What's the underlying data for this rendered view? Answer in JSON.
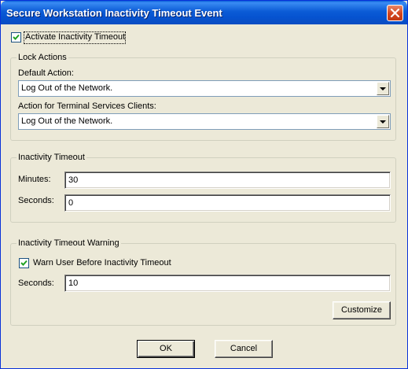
{
  "window": {
    "title": "Secure Workstation Inactivity Timeout Event"
  },
  "activate_timeout": {
    "label": "Activate Inactivity Timeout",
    "checked": true
  },
  "lock_actions": {
    "title": "Lock Actions",
    "default_action": {
      "label": "Default Action:",
      "value": "Log Out of the Network."
    },
    "terminal_services": {
      "label": "Action for Terminal Services Clients:",
      "value": "Log Out of the Network."
    }
  },
  "inactivity_timeout": {
    "title": "Inactivity Timeout",
    "minutes": {
      "label": "Minutes:",
      "value": "30"
    },
    "seconds": {
      "label": "Seconds:",
      "value": "0"
    }
  },
  "timeout_warning": {
    "title": "Inactivity Timeout Warning",
    "warn_user": {
      "label": "Warn User Before Inactivity Timeout",
      "checked": true
    },
    "seconds": {
      "label": "Seconds:",
      "value": "10"
    },
    "customize_label": "Customize"
  },
  "buttons": {
    "ok": "OK",
    "cancel": "Cancel"
  },
  "icons": {
    "close": "close-icon",
    "check": "checkmark-icon",
    "dropdown": "chevron-down-icon"
  }
}
